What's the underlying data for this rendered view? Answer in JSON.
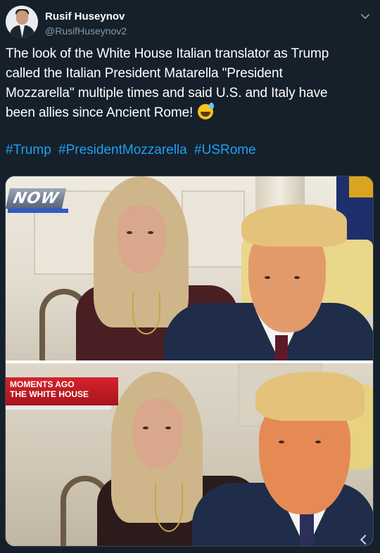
{
  "author": {
    "name": "Rusif Huseynov",
    "handle": "@RusifHuseynov2",
    "avatar_icon": "person-avatar"
  },
  "menu_icon": "chevron-down-icon",
  "tweet": {
    "lines": [
      "The look of the White House Italian translator as Trump",
      "called the Italian President Matarella \"President",
      "Mozzarella\" multiple times and said U.S. and Italy have",
      "been allies since Ancient Rome!"
    ],
    "emoji": "grinning-face-with-sweat-emoji",
    "hashtags": [
      "#Trump",
      "#PresidentMozzarella",
      "#USRome"
    ]
  },
  "media": {
    "top_frame": {
      "logo_text": "NOW"
    },
    "bottom_frame": {
      "banner_line1": "MOMENTS AGO",
      "banner_line2": "THE WHITE HOUSE"
    }
  },
  "colors": {
    "background": "#15202b",
    "text": "#ffffff",
    "secondary_text": "#8899a6",
    "hashtag": "#1da1f2"
  }
}
